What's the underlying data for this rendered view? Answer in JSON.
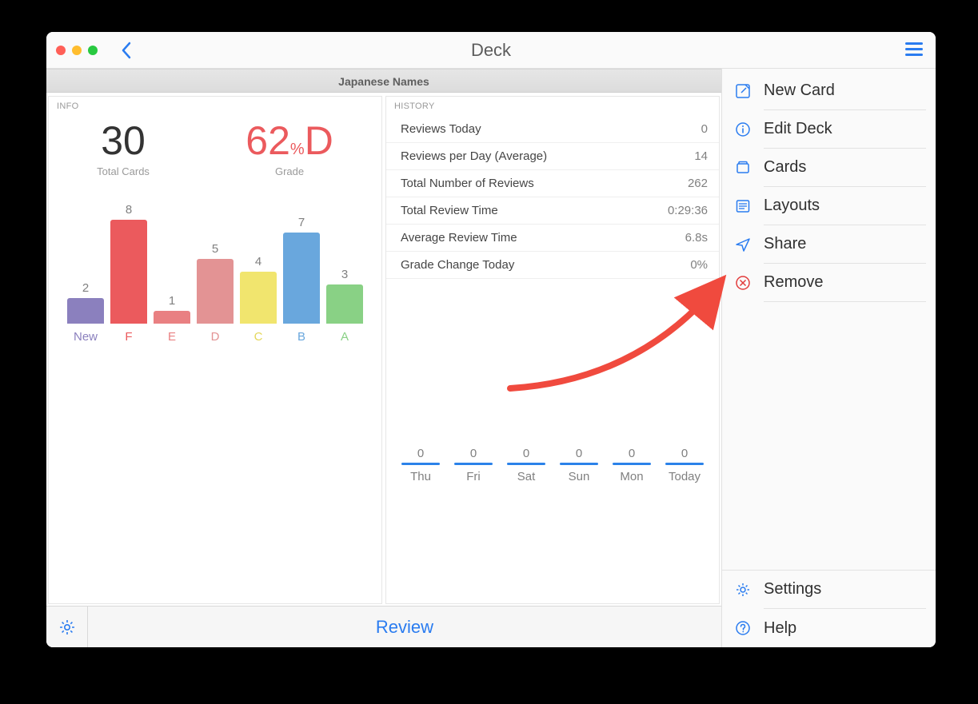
{
  "window": {
    "title": "Deck"
  },
  "deck": {
    "name": "Japanese Names"
  },
  "info": {
    "panel_label": "INFO",
    "total_cards": "30",
    "total_cards_label": "Total Cards",
    "grade_value": "62",
    "grade_pct": "%",
    "grade_letter": "D",
    "grade_label": "Grade"
  },
  "history": {
    "panel_label": "HISTORY",
    "rows": [
      {
        "label": "Reviews Today",
        "value": "0"
      },
      {
        "label": "Reviews per Day (Average)",
        "value": "14"
      },
      {
        "label": "Total Number of Reviews",
        "value": "262"
      },
      {
        "label": "Total Review Time",
        "value": "0:29:36"
      },
      {
        "label": "Average Review Time",
        "value": "6.8s"
      },
      {
        "label": "Grade Change Today",
        "value": "0%"
      }
    ],
    "days": [
      {
        "label": "Thu",
        "value": "0"
      },
      {
        "label": "Fri",
        "value": "0"
      },
      {
        "label": "Sat",
        "value": "0"
      },
      {
        "label": "Sun",
        "value": "0"
      },
      {
        "label": "Mon",
        "value": "0"
      },
      {
        "label": "Today",
        "value": "0"
      }
    ]
  },
  "toolbar": {
    "review_label": "Review"
  },
  "sidebar": {
    "items": [
      {
        "label": "New Card"
      },
      {
        "label": "Edit Deck"
      },
      {
        "label": "Cards"
      },
      {
        "label": "Layouts"
      },
      {
        "label": "Share"
      },
      {
        "label": "Remove"
      }
    ],
    "bottom": [
      {
        "label": "Settings"
      },
      {
        "label": "Help"
      }
    ]
  },
  "chart_data": {
    "type": "bar",
    "categories": [
      "New",
      "F",
      "E",
      "D",
      "C",
      "B",
      "A"
    ],
    "values": [
      2,
      8,
      1,
      5,
      4,
      7,
      3
    ],
    "colors": [
      "#8b80be",
      "#eb5a5d",
      "#e98082",
      "#e39394",
      "#f1e56e",
      "#69a7dd",
      "#89d185"
    ],
    "label_colors": [
      "#8b80be",
      "#eb5a5d",
      "#e98082",
      "#e39394",
      "#e4d75a",
      "#69a7dd",
      "#89d185"
    ],
    "ylim": [
      0,
      8
    ],
    "title": "",
    "xlabel": "",
    "ylabel": ""
  }
}
